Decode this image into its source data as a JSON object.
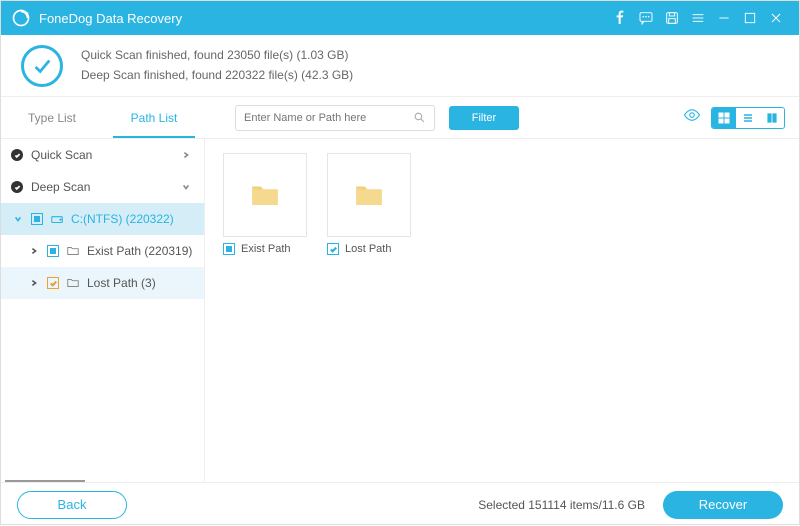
{
  "app": {
    "title": "FoneDog Data Recovery"
  },
  "status": {
    "line1": "Quick Scan finished, found 23050 file(s) (1.03 GB)",
    "line2": "Deep Scan finished, found 220322 file(s) (42.3 GB)"
  },
  "tabs": {
    "type_list": "Type List",
    "path_list": "Path List",
    "active": "path_list"
  },
  "search": {
    "placeholder": "Enter Name or Path here"
  },
  "buttons": {
    "filter": "Filter",
    "back": "Back",
    "recover": "Recover"
  },
  "sidebar": {
    "quick_scan": "Quick Scan",
    "deep_scan": "Deep Scan",
    "drive": "C:(NTFS) (220322)",
    "exist_path": "Exist Path (220319)",
    "lost_path": "Lost Path (3)"
  },
  "folders": {
    "exist": "Exist Path",
    "lost": "Lost Path"
  },
  "footer": {
    "selected": "Selected 151114 items/11.6 GB"
  },
  "colors": {
    "accent": "#29b4e2"
  }
}
